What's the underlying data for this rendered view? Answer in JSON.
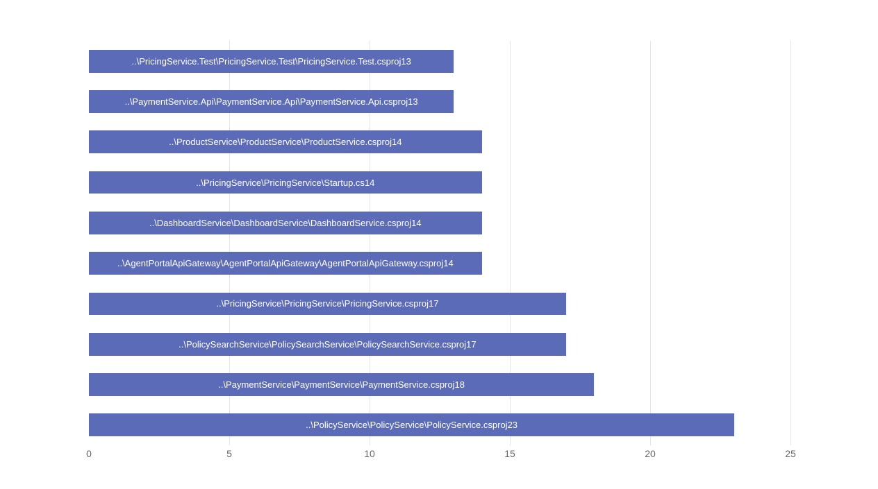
{
  "chart_data": {
    "type": "bar",
    "orientation": "horizontal",
    "xlabel": "",
    "ylabel": "",
    "title": "",
    "xlim": [
      0,
      25
    ],
    "xticks": [
      0,
      5,
      10,
      15,
      20,
      25
    ],
    "bar_color": "#5b6bb7",
    "items": [
      {
        "label": "..\\PricingService.Test\\PricingService.Test\\PricingService.Test.csproj",
        "value": 13
      },
      {
        "label": "..\\PaymentService.Api\\PaymentService.Api\\PaymentService.Api.csproj",
        "value": 13
      },
      {
        "label": "..\\ProductService\\ProductService\\ProductService.csproj",
        "value": 14
      },
      {
        "label": "..\\PricingService\\PricingService\\Startup.cs",
        "value": 14
      },
      {
        "label": "..\\DashboardService\\DashboardService\\DashboardService.csproj",
        "value": 14
      },
      {
        "label": "..\\AgentPortalApiGateway\\AgentPortalApiGateway\\AgentPortalApiGateway.csproj",
        "value": 14
      },
      {
        "label": "..\\PricingService\\PricingService\\PricingService.csproj",
        "value": 17
      },
      {
        "label": "..\\PolicySearchService\\PolicySearchService\\PolicySearchService.csproj",
        "value": 17
      },
      {
        "label": "..\\PaymentService\\PaymentService\\PaymentService.csproj",
        "value": 18
      },
      {
        "label": "..\\PolicyService\\PolicyService\\PolicyService.csproj",
        "value": 23
      }
    ]
  }
}
